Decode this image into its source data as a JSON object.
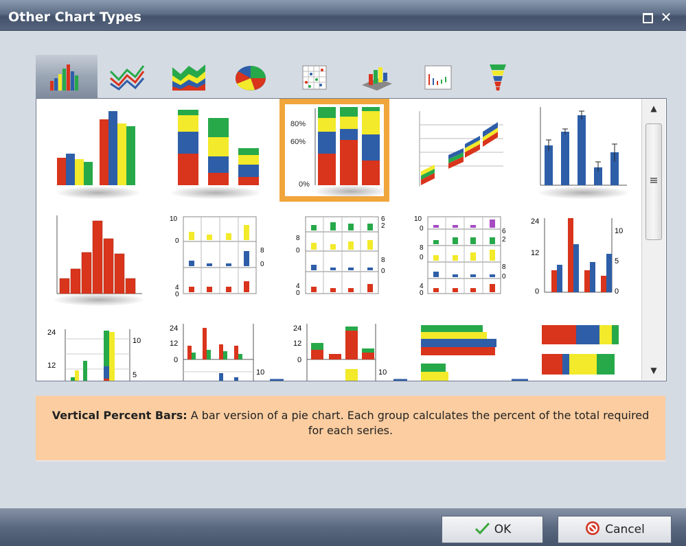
{
  "window": {
    "title": "Other Chart Types"
  },
  "tabs": [
    {
      "icon": "bar-chart-icon"
    },
    {
      "icon": "line-chart-icon"
    },
    {
      "icon": "area-chart-icon"
    },
    {
      "icon": "pie-chart-icon"
    },
    {
      "icon": "scatter-chart-icon"
    },
    {
      "icon": "3d-bar-chart-icon"
    },
    {
      "icon": "stock-chart-icon"
    },
    {
      "icon": "funnel-chart-icon"
    }
  ],
  "gallery": {
    "labels": {
      "percent_80": "80%",
      "percent_60": "60%",
      "percent_0": "0%",
      "v10": "10",
      "v0": "0",
      "v8": "8",
      "v4": "4",
      "v6": "6",
      "v2": "2",
      "v24": "24",
      "v12": "12",
      "v5": "5"
    }
  },
  "description": {
    "heading": "Vertical Percent Bars:",
    "text": " A bar version of a pie chart. Each group calculates the percent of the total required for each series."
  },
  "buttons": {
    "ok": "OK",
    "cancel": "Cancel"
  },
  "colors": {
    "red": "#d9341c",
    "blue": "#2e5ea8",
    "yellow": "#f2ea2a",
    "green": "#27a94a",
    "purple": "#a64bc2",
    "selection": "#f0a63b"
  }
}
